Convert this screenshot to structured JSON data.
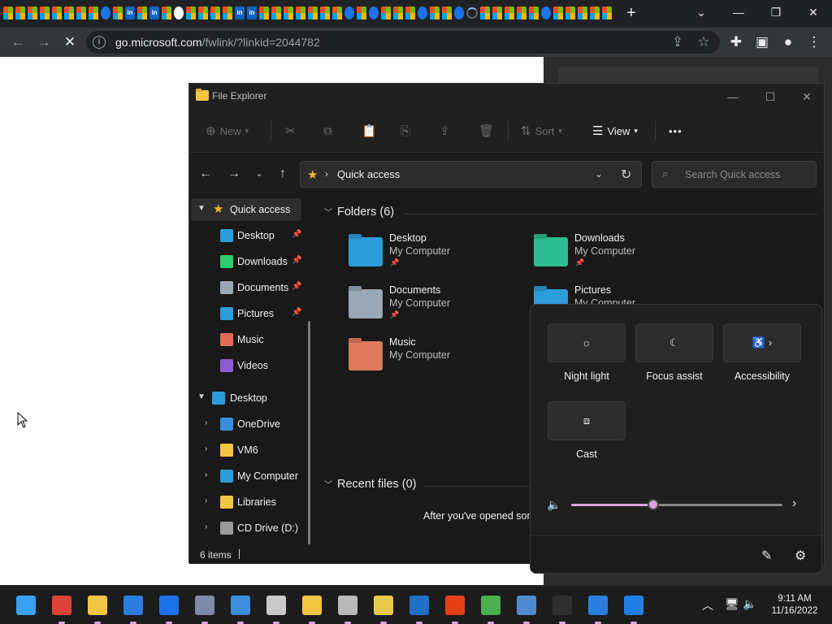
{
  "browser": {
    "url_host": "go.microsoft.com",
    "url_path": "/fwlink/?linkid=2044782",
    "tab_icons": [
      "ms",
      "ms",
      "ms",
      "ms",
      "ms",
      "ms",
      "ms",
      "ms",
      "ed",
      "ms",
      "li",
      "ms",
      "li",
      "ms",
      "gh",
      "ms",
      "ms",
      "ms",
      "ms",
      "li",
      "li",
      "ms",
      "ms",
      "ms",
      "ms",
      "ms",
      "ms",
      "ms",
      "ed",
      "ms",
      "ed",
      "ms",
      "ms",
      "ms",
      "ed",
      "ms",
      "ms",
      "ed",
      "ld",
      "ms",
      "ms",
      "ms",
      "ms",
      "ms",
      "ed",
      "ms",
      "ms",
      "ms",
      "ms",
      "ms"
    ],
    "li_text": "in"
  },
  "explorer": {
    "title": "File Explorer",
    "cmdbar": {
      "new": "New",
      "sort": "Sort",
      "view": "View",
      "more": "•••"
    },
    "address": {
      "path": "Quick access"
    },
    "search": {
      "placeholder": "Search Quick access"
    },
    "nav": {
      "quick_access": "Quick access",
      "quick_items": [
        {
          "label": "Desktop",
          "pinned": true
        },
        {
          "label": "Downloads",
          "pinned": true
        },
        {
          "label": "Documents",
          "pinned": true
        },
        {
          "label": "Pictures",
          "pinned": true
        },
        {
          "label": "Music",
          "pinned": false
        },
        {
          "label": "Videos",
          "pinned": false
        }
      ],
      "desktop": "Desktop",
      "desktop_items": [
        "OneDrive",
        "VM6",
        "My Computer",
        "Libraries",
        "CD Drive (D:)"
      ]
    },
    "folders_header": "Folders (6)",
    "folders": [
      {
        "name": "Desktop",
        "location": "My Computer"
      },
      {
        "name": "Downloads",
        "location": "My Computer"
      },
      {
        "name": "Documents",
        "location": "My Computer"
      },
      {
        "name": "Pictures",
        "location": "My Computer"
      },
      {
        "name": "Music",
        "location": "My Computer"
      }
    ],
    "recent_header": "Recent files (0)",
    "empty_message": "After you've opened som",
    "status": {
      "count": "6 items"
    }
  },
  "quick_settings": {
    "tiles": [
      {
        "label": "Night light",
        "icon": "brightness-icon"
      },
      {
        "label": "Focus assist",
        "icon": "moon-icon"
      },
      {
        "label": "Accessibility",
        "icon": "accessibility-icon"
      },
      {
        "label": "Cast",
        "icon": "cast-icon"
      }
    ],
    "volume": 0.39,
    "accent": "#d9a4d9"
  },
  "taskbar": {
    "time": "9:11 AM",
    "date": "11/16/2022",
    "apps": [
      {
        "name": "start-button",
        "color": "#3aa0f2"
      },
      {
        "name": "chrome-app",
        "color": "#db4437"
      },
      {
        "name": "file-explorer-app",
        "color": "#f4c542"
      },
      {
        "name": "photos-app",
        "color": "#2b7de0"
      },
      {
        "name": "defender-app",
        "color": "#1a73e8"
      },
      {
        "name": "network-app",
        "color": "#7d8aa8"
      },
      {
        "name": "notepad-app",
        "color": "#3b8ede"
      },
      {
        "name": "paint-app",
        "color": "#c9c9c9"
      },
      {
        "name": "folder-user-app",
        "color": "#f4c542"
      },
      {
        "name": "archive-app",
        "color": "#b9b9b9"
      },
      {
        "name": "media-app",
        "color": "#e7c94a"
      },
      {
        "name": "remote-desktop-app",
        "color": "#1f6fc4"
      },
      {
        "name": "office-app",
        "color": "#e3401a"
      },
      {
        "name": "globe-app",
        "color": "#4caf50"
      },
      {
        "name": "hyperv-app",
        "color": "#4f8ad1"
      },
      {
        "name": "terminal-app",
        "color": "#2f2f2f"
      },
      {
        "name": "mail-app",
        "color": "#2b7de0"
      },
      {
        "name": "calendar-app",
        "color": "#1f7fe6"
      }
    ]
  }
}
